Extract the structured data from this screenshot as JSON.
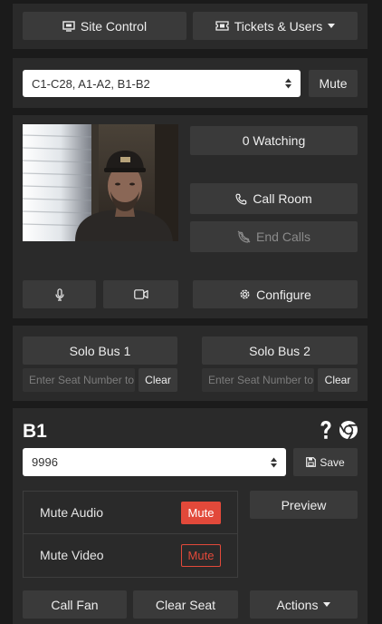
{
  "header": {
    "site_control_label": "Site Control",
    "tickets_users_label": "Tickets & Users"
  },
  "seat_group": {
    "selected": "C1-C28, A1-A2, B1-B2",
    "mute_label": "Mute"
  },
  "room": {
    "watching_label": "0 Watching",
    "call_room_label": "Call Room",
    "end_calls_label": "End Calls",
    "configure_label": "Configure"
  },
  "solo_buses": [
    {
      "label": "Solo Bus 1",
      "placeholder": "Enter Seat Number to",
      "clear_label": "Clear"
    },
    {
      "label": "Solo Bus 2",
      "placeholder": "Enter Seat Number to",
      "clear_label": "Clear"
    }
  ],
  "seat": {
    "title": "B1",
    "selected": "9996",
    "save_label": "Save",
    "preview_label": "Preview",
    "mute_audio_label": "Mute Audio",
    "mute_audio_button": "Mute",
    "mute_video_label": "Mute Video",
    "mute_video_button": "Mute",
    "call_fan_label": "Call Fan",
    "clear_seat_label": "Clear Seat",
    "actions_label": "Actions"
  },
  "colors": {
    "danger": "#e2493a",
    "panel": "#2a2a2a",
    "button": "#3a3a3a"
  }
}
